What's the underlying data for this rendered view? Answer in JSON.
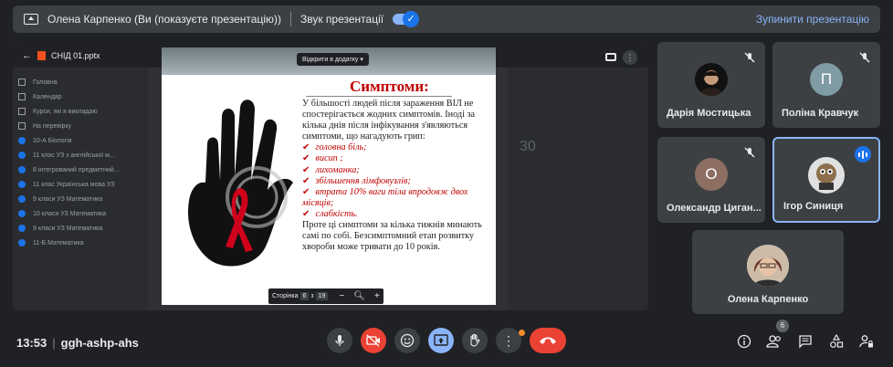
{
  "topbar": {
    "presenter_text": "Олена Карпенко (Ви (показуєте презентацію))",
    "sound_label": "Звук презентації",
    "stop_label": "Зупинити презентацію"
  },
  "drive": {
    "filename": "СНІД 01.pptx",
    "open_with": "Відкрити в додатку",
    "page_label": "Сторінка",
    "page_current": "6",
    "page_sep": "з",
    "page_total": "19",
    "bg_number": "30",
    "classroom_items": [
      {
        "icon": "home",
        "label": "Головна"
      },
      {
        "icon": "calendar",
        "label": "Календар"
      },
      {
        "icon": "people",
        "label": "Курси, які я викладаю"
      },
      {
        "icon": "check",
        "label": "На перевірку"
      },
      {
        "icon": "class",
        "label": "10-А Біологія"
      },
      {
        "icon": "class",
        "label": "11 клас УЗ з англійської м..."
      },
      {
        "icon": "class",
        "label": "8 інтегрований предметний..."
      },
      {
        "icon": "class",
        "label": "11 клас Українська мова УЗ"
      },
      {
        "icon": "class",
        "label": "9 класи УЗ Математика"
      },
      {
        "icon": "class",
        "label": "10 класи УЗ Математика"
      },
      {
        "icon": "class",
        "label": "9 класи УЗ Математика"
      },
      {
        "icon": "class",
        "label": "11-Б Математика"
      }
    ]
  },
  "slide": {
    "title": "Симптоми:",
    "intro": "У більшості людей після зараження ВІЛ не спостерігається жодних симптомів. Іноді за кілька днів після інфікування з'являються симптоми, що нагадують грип:",
    "symptoms": [
      "головна біль;",
      "висип ;",
      "лихоманка;",
      "збільшення лімфовузлів;",
      "втрата 10% ваги тіла впродовж двох місяців;",
      "слабкість."
    ],
    "outro": "Проте ці симптоми за кілька тижнів минають самі по собі. Безсимптомний етап розвитку хвороби може тривати до 10 років."
  },
  "participants": [
    {
      "name": "Дарія Мостицька",
      "avatar_type": "photo",
      "muted": true
    },
    {
      "name": "Поліна Кравчук",
      "initial": "П",
      "avatar_color": "#7f9ba3",
      "muted": true
    },
    {
      "name": "Олександр Циган...",
      "initial": "О",
      "avatar_color": "#8d6e63",
      "muted": true
    },
    {
      "name": "Ігор Синиця",
      "avatar_type": "photo",
      "speaking": true
    },
    {
      "name": "Олена Карпенко",
      "avatar_type": "photo"
    }
  ],
  "bottombar": {
    "time": "13:53",
    "meeting_code": "ggh-ashp-ahs",
    "people_count": "6"
  },
  "colors": {
    "accent": "#8ab4f8",
    "danger": "#ea4335",
    "slide_red": "#c00000"
  }
}
